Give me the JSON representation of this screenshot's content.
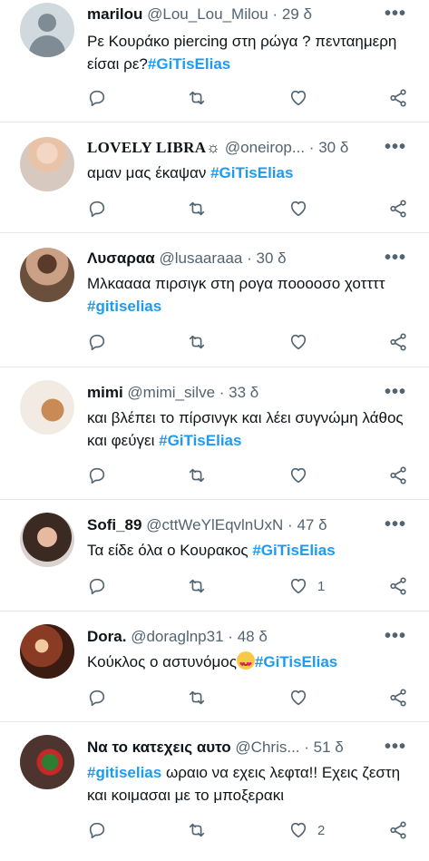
{
  "tweets": [
    {
      "name": "marilou",
      "handle": "@Lou_Lou_Milou",
      "time": "29 δ",
      "text": "Ρε Κουράκο piercing στη ρώγα ? πενταημερη είσαι ρε?",
      "tag": "#GiTisElias",
      "likes": ""
    },
    {
      "name": "LOVELY LIBRA☼",
      "handle": "@oneirop...",
      "time": "30 δ",
      "text": "αμαν μας έκαψαν ",
      "tag": "#GiTisElias",
      "likes": ""
    },
    {
      "name": "Λυσαραα",
      "handle": "@lusaaraaa",
      "time": "30 δ",
      "text": "Μλκαααα πιρσιγκ στη  ρογα πooooσο χοττττ ",
      "tag": "#gitiselias",
      "likes": ""
    },
    {
      "name": "mimi",
      "handle": "@mimi_silve",
      "time": "33 δ",
      "text": "και βλέπει το πίρσινγκ και λέει συγνώμη λάθος και φεύγει ",
      "tag": "#GiTisElias",
      "likes": ""
    },
    {
      "name": "Sofi_89",
      "handle": "@cttWeYlEqvlnUxN",
      "time": "47 δ",
      "text": "Τα είδε όλα ο Κουρακος ",
      "tag": "#GiTisElias",
      "likes": "1"
    },
    {
      "name": "Dora.",
      "handle": "@doraglnp31",
      "time": "48 δ",
      "text": "Κούκλος ο αστυνόμος",
      "tag": "#GiTisElias",
      "likes": ""
    },
    {
      "name": "Να το κατεχεις αυτο",
      "handle": "@Chris...",
      "time": "51 δ",
      "tag": "#gitiselias",
      "text": " ωραιο να εχεις λεφτα!! Εχεις ζεστη και κοιμασαι με το μποξερακι",
      "likes": "2"
    }
  ],
  "ui": {
    "separator": "·",
    "more_glyph": "•••"
  }
}
